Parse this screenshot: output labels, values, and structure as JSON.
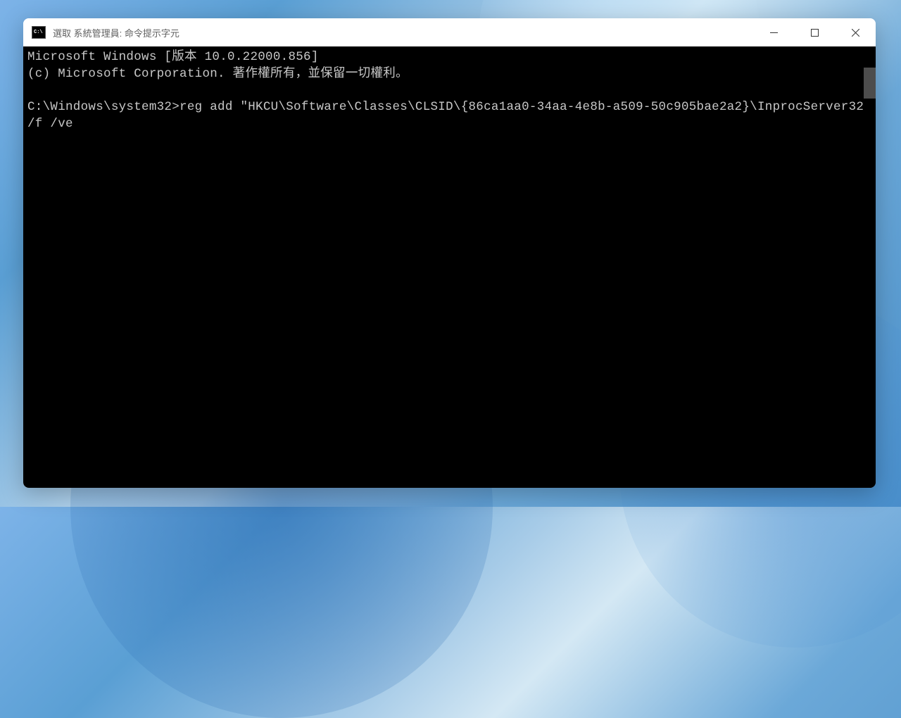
{
  "window": {
    "title": "選取 系統管理員: 命令提示字元",
    "icon_text": "C:\\"
  },
  "terminal": {
    "line1": "Microsoft Windows [版本 10.0.22000.856]",
    "line2": "(c) Microsoft Corporation. 著作權所有，並保留一切權利。",
    "blank": "",
    "prompt_line": "C:\\Windows\\system32>reg add \"HKCU\\Software\\Classes\\CLSID\\{86ca1aa0-34aa-4e8b-a509-50c905bae2a2}\\InprocServer32\" /f /ve"
  }
}
